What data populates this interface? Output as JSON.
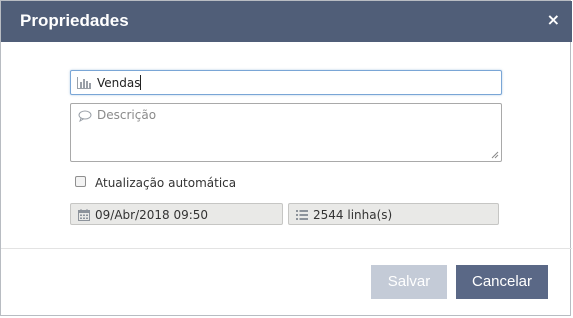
{
  "dialog": {
    "title": "Propriedades",
    "close_glyph": "×"
  },
  "form": {
    "name_value": "Vendas",
    "name_icon": "bar-chart-icon",
    "description_placeholder": "Descrição",
    "description_icon": "speech-bubble-icon",
    "auto_update_label": "Atualização automática",
    "auto_update_checked": false,
    "date_value": "09/Abr/2018 09:50",
    "date_icon": "calendar-icon",
    "rows_value": "2544 linha(s)",
    "rows_icon": "list-icon"
  },
  "footer": {
    "save_label": "Salvar",
    "cancel_label": "Cancelar"
  },
  "colors": {
    "titlebar": "#505e78",
    "save_disabled": "#c4cbd7",
    "cancel": "#5a6886"
  }
}
